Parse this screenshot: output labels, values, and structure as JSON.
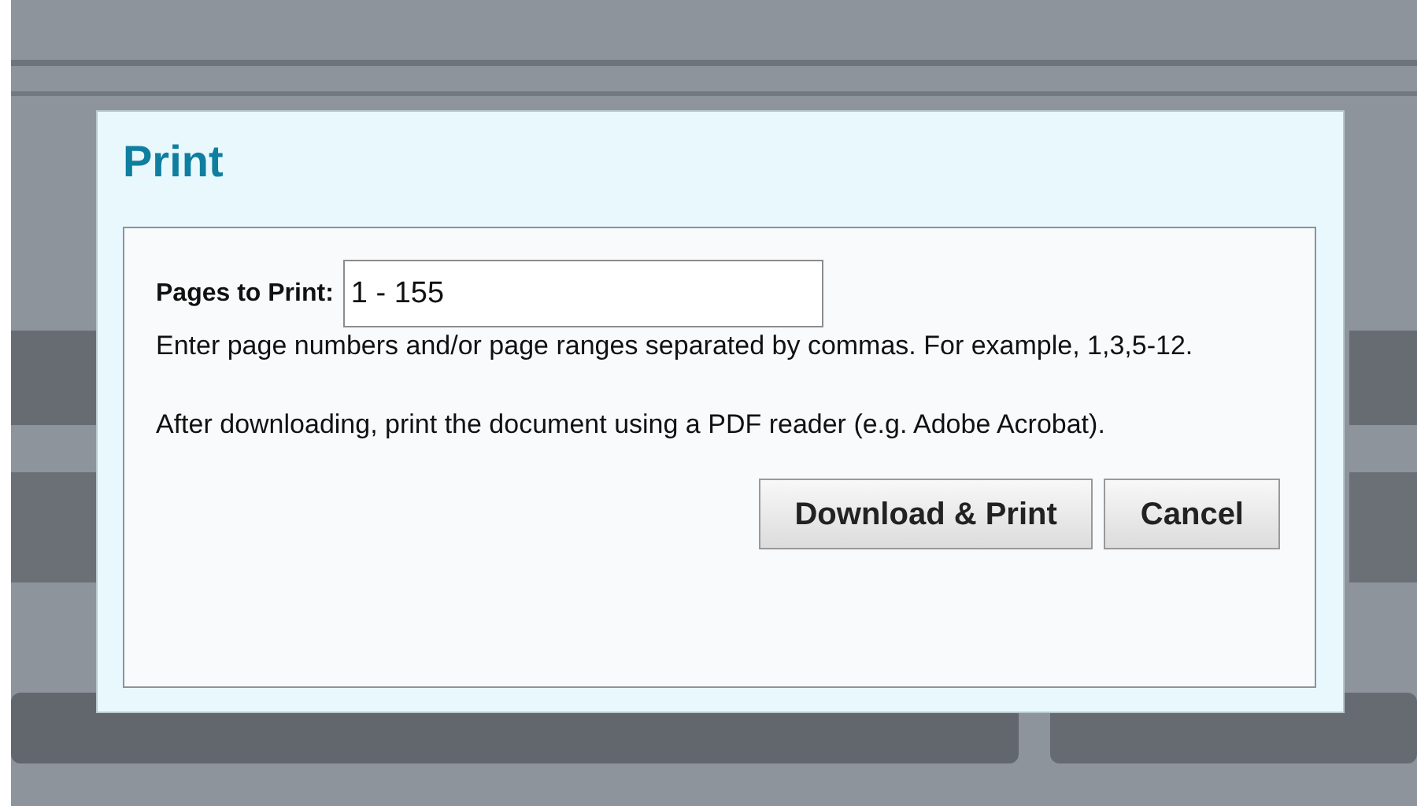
{
  "dialog": {
    "title": "Print",
    "pages_label": "Pages to Print:",
    "pages_value": "1 - 155",
    "hint": "Enter page numbers and/or page ranges separated by commas. For example, 1,3,5-12.",
    "note": "After downloading, print the document using a PDF reader (e.g. Adobe Acrobat).",
    "buttons": [
      "Download & Print",
      "Cancel"
    ]
  }
}
